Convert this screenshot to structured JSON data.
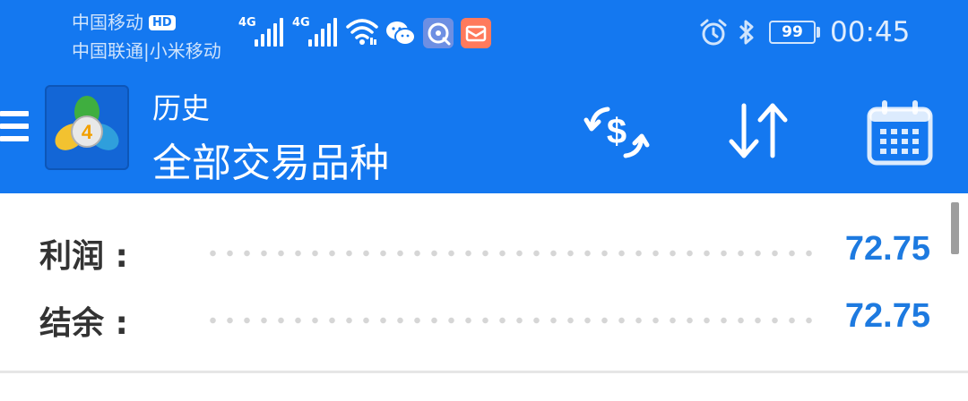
{
  "status_bar": {
    "carrier_primary": "中国移动",
    "hd_badge": "HD",
    "carrier_secondary": "中国联通|小米移动",
    "signal_1_label": "4G",
    "signal_2_label": "4G",
    "battery": "99",
    "time": "00:45",
    "icons": [
      "signal-icon",
      "wifi-icon",
      "wechat-icon",
      "browser-app-icon",
      "mail-app-icon",
      "alarm-icon",
      "bluetooth-icon",
      "battery-icon"
    ]
  },
  "toolbar": {
    "title": "历史",
    "subtitle": "全部交易品种",
    "icons": [
      "menu-icon",
      "metatrader-logo",
      "currency-exchange-icon",
      "sort-icon",
      "calendar-icon"
    ]
  },
  "summary": {
    "profit_label": "利润 :",
    "profit_value": "72.75",
    "balance_label": "结余 :",
    "balance_value": "72.75"
  },
  "colors": {
    "header_blue": "#1478f0",
    "value_blue": "#1d7ae0",
    "label_text": "#333333"
  }
}
